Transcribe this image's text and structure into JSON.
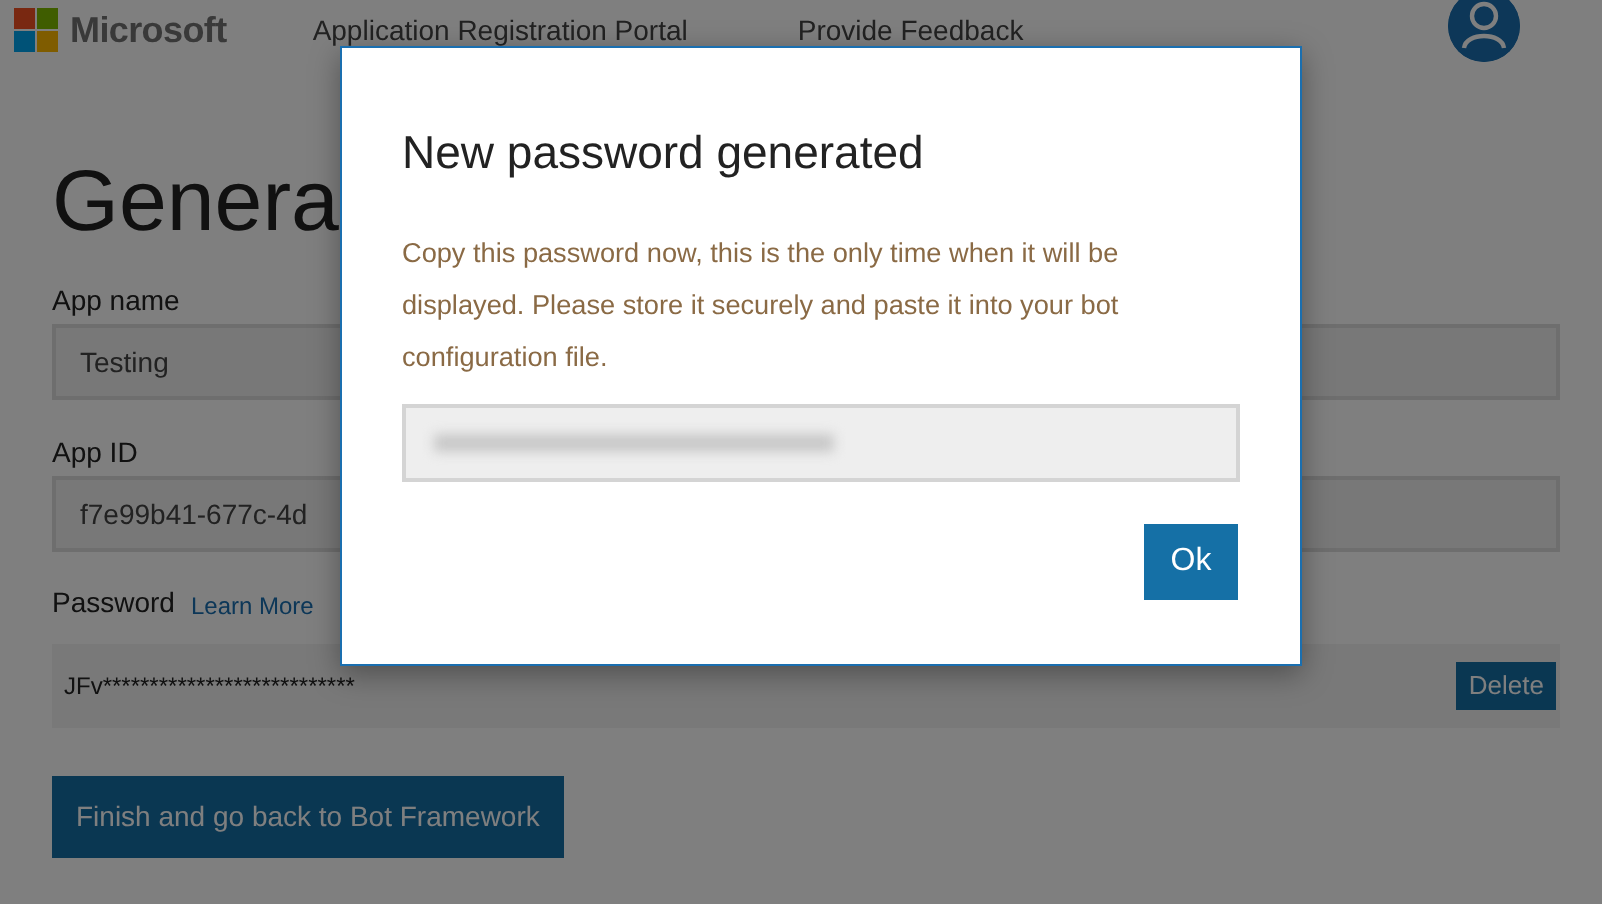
{
  "header": {
    "brand": "Microsoft",
    "nav": [
      {
        "label": "Application Registration Portal"
      },
      {
        "label": "Provide Feedback"
      }
    ]
  },
  "page": {
    "heading_left": "Genera",
    "fields": [
      {
        "label": "App name",
        "value": "Testing"
      },
      {
        "label": "App ID",
        "value": "f7e99b41-677c-4d"
      }
    ],
    "password": {
      "label": "Password",
      "link": "Learn More",
      "value": "JFv***************************",
      "delete_button": "Delete"
    },
    "finish_button": "Finish and go back to Bot Framework"
  },
  "dialog": {
    "title": "New password generated",
    "message": "Copy this password now, this is the only time when it will be displayed. Please store it securely and paste it into your bot configuration file.",
    "ok_button": "Ok"
  }
}
